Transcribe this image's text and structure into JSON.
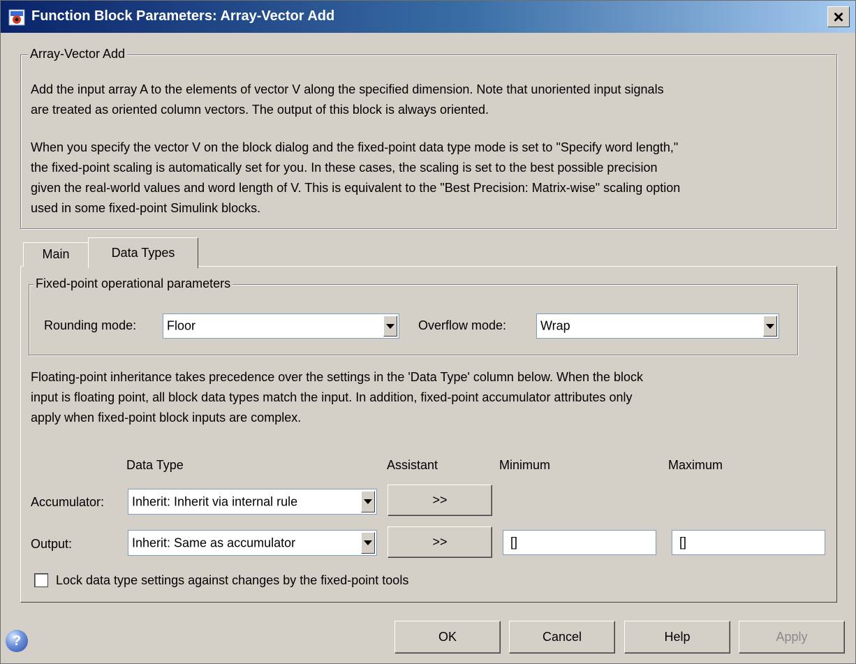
{
  "window": {
    "title": "Function Block Parameters: Array-Vector Add",
    "close_glyph": "×"
  },
  "description": {
    "group_title": "Array-Vector Add",
    "lines": [
      "Add the input array A to the elements of vector V along the specified dimension.  Note that unoriented input signals",
      "are treated as oriented column vectors. The output of this block is always oriented.",
      "",
      "When you specify the vector V on the block dialog and the fixed-point data type mode is set to \"Specify word length,\"",
      "the fixed-point scaling is automatically set for you. In these cases, the scaling is set to the best possible precision",
      "given the real-world values and word length of V. This is equivalent to the \"Best Precision: Matrix-wise\" scaling option",
      "used in some fixed-point Simulink blocks."
    ]
  },
  "tabs": [
    {
      "label": "Main",
      "active": false
    },
    {
      "label": "Data Types",
      "active": true
    }
  ],
  "fixed_point": {
    "group_title": "Fixed-point operational parameters",
    "rounding_label": "Rounding mode:",
    "rounding_value": "Floor",
    "overflow_label": "Overflow mode:",
    "overflow_value": "Wrap"
  },
  "note_lines": [
    "Floating-point inheritance takes precedence over the settings in the 'Data Type' column below. When the block",
    "input is floating point, all block data types match the input. In addition, fixed-point accumulator attributes only",
    "apply when fixed-point block inputs are complex."
  ],
  "table": {
    "headers": {
      "data_type": "Data Type",
      "assistant": "Assistant",
      "minimum": "Minimum",
      "maximum": "Maximum"
    },
    "rows": [
      {
        "label": "Accumulator:",
        "data_type": "Inherit: Inherit via internal rule",
        "assistant": ">>"
      },
      {
        "label": "Output:",
        "data_type": "Inherit: Same as accumulator",
        "assistant": ">>",
        "minimum": "[]",
        "maximum": "[]"
      }
    ]
  },
  "lock_checkbox": {
    "label": "Lock data type settings against changes by the fixed-point tools",
    "checked": false
  },
  "buttons": {
    "ok": "OK",
    "cancel": "Cancel",
    "help": "Help",
    "apply": "Apply"
  },
  "help_icon_glyph": "?"
}
